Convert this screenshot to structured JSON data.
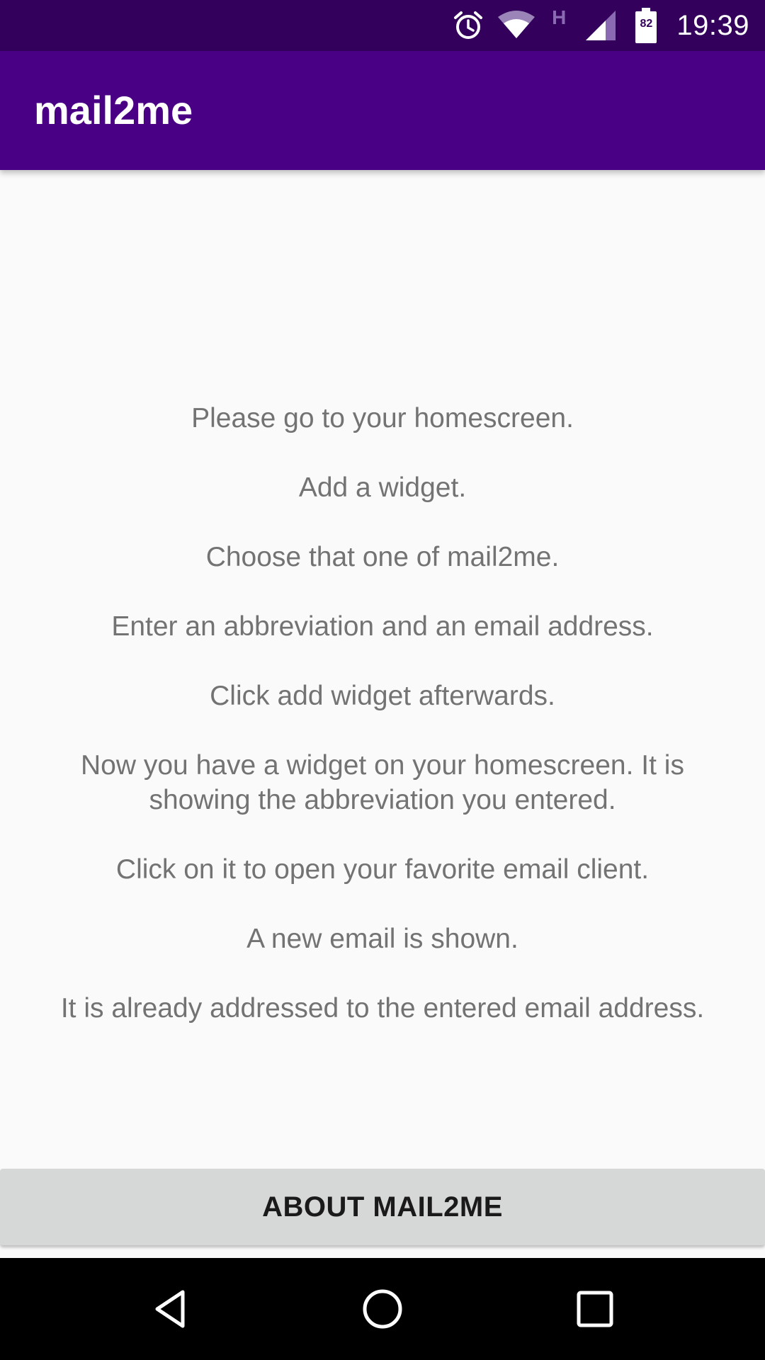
{
  "status_bar": {
    "time": "19:39",
    "network_type": "H",
    "battery_level": "82",
    "icons": [
      "alarm-icon",
      "wifi-icon",
      "network-type-icon",
      "cell-signal-icon",
      "battery-icon"
    ]
  },
  "app_bar": {
    "title": "mail2me"
  },
  "instructions": [
    "Please go to your homescreen.",
    "Add a widget.",
    "Choose that one of mail2me.",
    "Enter an abbreviation and an email address.",
    "Click add widget afterwards.",
    "Now you have a widget on your homescreen. It is showing the abbreviation you entered.",
    "Click on it to open your favorite email client.",
    "A new email is shown.",
    "It is already addressed to the entered email address."
  ],
  "about_button": {
    "label": "ABOUT MAIL2ME"
  },
  "nav_bar": {
    "icons": [
      "back-icon",
      "home-icon",
      "recents-icon"
    ]
  },
  "colors": {
    "status_bar": "#33005c",
    "app_bar": "#4a0085",
    "background": "#fafafa",
    "body_text": "#737373",
    "button_bg": "#d6d7d7"
  }
}
